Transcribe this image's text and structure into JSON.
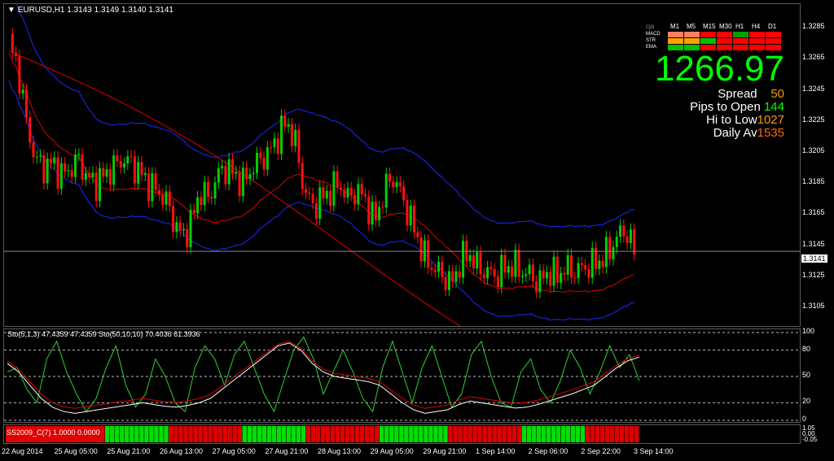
{
  "header": {
    "symbol_tf": "EURUSD,H1",
    "ohlc": "1.3143 1.3149 1.3140 1.3141"
  },
  "mtf": {
    "brand": "cja",
    "timeframes": [
      "M1",
      "M5",
      "M15",
      "M30",
      "H1",
      "H4",
      "D1"
    ],
    "rows": [
      {
        "label": "MACD",
        "colors": [
          "#ff8060",
          "#ff8060",
          "#ff0000",
          "#ff0000",
          "#00a000",
          "#ff0000",
          "#ff0000"
        ]
      },
      {
        "label": "STR",
        "colors": [
          "#ffa000",
          "#ffa000",
          "#00c000",
          "#ff0000",
          "#ff0000",
          "#ff0000",
          "#ff0000"
        ]
      },
      {
        "label": "EMA",
        "colors": [
          "#00c000",
          "#00c000",
          "#ff0000",
          "#ff0000",
          "#ff0000",
          "#ff0000",
          "#ff0000"
        ]
      }
    ]
  },
  "stats": {
    "big": "1266.97",
    "spread_label": "Spread",
    "spread": "50",
    "pips_label": "Pips to Open",
    "pips": "144",
    "hilo_label": "Hi to Low",
    "hilo": "1027",
    "daily_label": "Daily Av",
    "daily": "1535"
  },
  "price_scale": {
    "ticks": [
      "1.3285",
      "1.3265",
      "1.3245",
      "1.3225",
      "1.3205",
      "1.3185",
      "1.3165",
      "1.3145",
      "1.3125",
      "1.3105"
    ],
    "current": "1.3141"
  },
  "sto": {
    "legend": "Sto(5,1,3) 47.4359 47.4359  Sto(50,10,10) 70.4036 61.3936",
    "levels": [
      "100",
      "80",
      "50",
      "20",
      "0"
    ]
  },
  "ssb": {
    "legend": "SS2009_C(7) 1.0000 0.0000",
    "scale": [
      "1.05",
      "0.00",
      "-0.05"
    ]
  },
  "time_axis": [
    "22 Aug 2014",
    "25 Aug 05:00",
    "25 Aug 21:00",
    "26 Aug 13:00",
    "27 Aug 05:00",
    "27 Aug 21:00",
    "28 Aug 13:00",
    "29 Aug 05:00",
    "29 Aug 21:00",
    "1 Sep 14:00",
    "2 Sep 06:00",
    "2 Sep 22:00",
    "3 Sep 14:00"
  ],
  "chart_data": [
    {
      "type": "candlestick",
      "symbol": "EURUSD",
      "timeframe": "H1",
      "close_path": [
        1.3275,
        1.326,
        1.3225,
        1.32,
        1.3195,
        1.3198,
        1.319,
        1.3194,
        1.32,
        1.3188,
        1.3185,
        1.319,
        1.3195,
        1.32,
        1.3198,
        1.3192,
        1.3185,
        1.318,
        1.3175,
        1.316,
        1.315,
        1.316,
        1.318,
        1.3175,
        1.319,
        1.3195,
        1.319,
        1.3185,
        1.3195,
        1.32,
        1.3205,
        1.3215,
        1.3225,
        1.321,
        1.318,
        1.317,
        1.3175,
        1.318,
        1.3185,
        1.3175,
        1.318,
        1.3175,
        1.316,
        1.3175,
        1.319,
        1.318,
        1.3165,
        1.315,
        1.3135,
        1.313,
        1.3125,
        1.312,
        1.3135,
        1.314,
        1.313,
        1.3128,
        1.3125,
        1.313,
        1.3132,
        1.3128,
        1.3126,
        1.312,
        1.3128,
        1.3125,
        1.313,
        1.3128,
        1.313,
        1.3132,
        1.3135,
        1.314,
        1.315,
        1.3155,
        1.3141
      ],
      "ylim": [
        1.3095,
        1.3295
      ],
      "current": 1.3141
    },
    {
      "type": "line",
      "name": "Sto(5,1,3)",
      "ylim": [
        0,
        100
      ],
      "levels": [
        80,
        50,
        20
      ],
      "series": [
        {
          "name": "main",
          "values": [
            55,
            60,
            35,
            20,
            70,
            90,
            55,
            30,
            10,
            25,
            60,
            85,
            40,
            15,
            30,
            70,
            50,
            20,
            10,
            60,
            85,
            70,
            40,
            75,
            90,
            60,
            30,
            10,
            45,
            80,
            95,
            70,
            30,
            55,
            80,
            55,
            25,
            10,
            60,
            90,
            55,
            20,
            60,
            85,
            50,
            15,
            30,
            75,
            90,
            50,
            20,
            15,
            55,
            70,
            35,
            20,
            45,
            80,
            60,
            30,
            55,
            85,
            60,
            75,
            45
          ]
        },
        {
          "name": "signal",
          "values": [
            65,
            55,
            40,
            25,
            15,
            10,
            8,
            10,
            12,
            14,
            16,
            18,
            20,
            18,
            16,
            15,
            17,
            20,
            25,
            35,
            45,
            55,
            65,
            75,
            85,
            88,
            80,
            65,
            55,
            50,
            48,
            46,
            44,
            40,
            30,
            20,
            12,
            8,
            10,
            12,
            18,
            22,
            20,
            18,
            16,
            14,
            15,
            18,
            22,
            26,
            30,
            35,
            40,
            50,
            60,
            68,
            72
          ]
        }
      ]
    }
  ]
}
